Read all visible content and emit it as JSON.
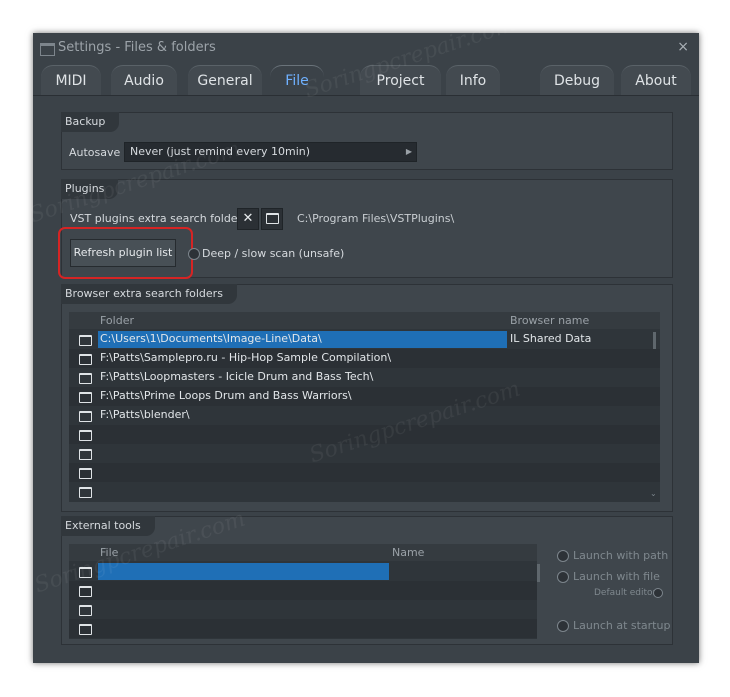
{
  "window": {
    "title": "Settings - Files & folders",
    "close_glyph": "×"
  },
  "tabs": [
    {
      "label": "MIDI"
    },
    {
      "label": "Audio"
    },
    {
      "label": "General"
    },
    {
      "label": "File",
      "active": true
    },
    {
      "label": "Project"
    },
    {
      "label": "Info"
    },
    {
      "label": "Debug"
    },
    {
      "label": "About"
    }
  ],
  "backup": {
    "title": "Backup",
    "autosave_label": "Autosave",
    "autosave_value": "Never (just remind every 10min)"
  },
  "plugins": {
    "title": "Plugins",
    "vst_label": "VST plugins extra search folder",
    "clear_glyph": "✕",
    "vst_path": "C:\\Program Files\\VSTPlugins\\",
    "refresh_label": "Refresh plugin list",
    "deep_scan_label": "Deep / slow scan (unsafe)"
  },
  "browser": {
    "title": "Browser extra search folders",
    "col_folder": "Folder",
    "col_name": "Browser name",
    "rows": [
      {
        "folder": "C:\\Users\\1\\Documents\\Image-Line\\Data\\",
        "name": "IL Shared Data",
        "selected": true
      },
      {
        "folder": "F:\\Patts\\Samplepro.ru - Hip-Hop Sample Compilation\\",
        "name": ""
      },
      {
        "folder": "F:\\Patts\\Loopmasters - Icicle Drum and Bass Tech\\",
        "name": ""
      },
      {
        "folder": "F:\\Patts\\Prime Loops Drum and Bass Warriors\\",
        "name": ""
      },
      {
        "folder": "F:\\Patts\\blender\\",
        "name": ""
      },
      {
        "folder": "",
        "name": ""
      },
      {
        "folder": "",
        "name": ""
      },
      {
        "folder": "",
        "name": ""
      },
      {
        "folder": "",
        "name": ""
      }
    ]
  },
  "external": {
    "title": "External tools",
    "col_file": "File",
    "col_name": "Name",
    "rows": [
      {
        "file": "",
        "selected": true
      },
      {
        "file": ""
      },
      {
        "file": ""
      },
      {
        "file": ""
      }
    ],
    "launch_with_path": "Launch with path",
    "launch_with_file": "Launch with file",
    "default_editor": "Default editor",
    "launch_at_startup": "Launch at startup"
  },
  "watermark": "Soringpcrepair.com",
  "colors": {
    "accent": "#6fb1ff",
    "selection": "#1f6fb6",
    "highlight": "#d62424"
  }
}
